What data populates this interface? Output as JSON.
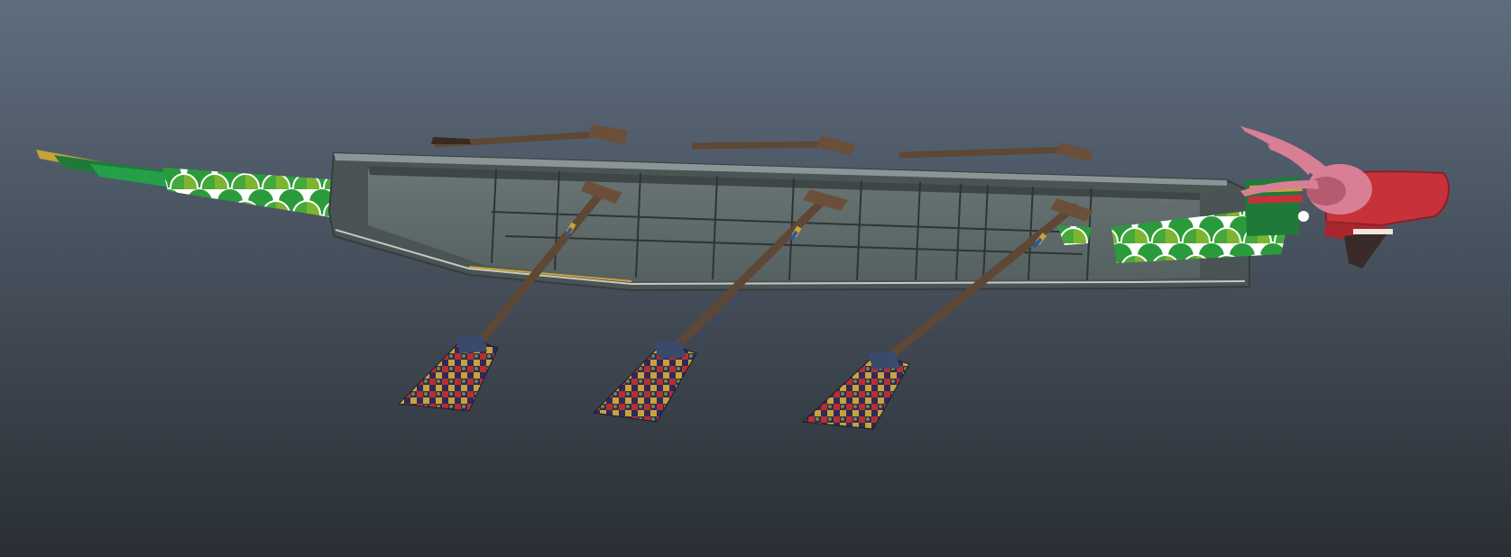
{
  "viewport": {
    "background_top": "#5f6d7e",
    "background_bottom": "#2a2f35"
  },
  "scene": {
    "object": "dragon-boat",
    "oars_count": 6,
    "colors": {
      "hull": "#5f6b6b",
      "hull_light": "#7e8a8a",
      "hull_dark": "#3e4646",
      "scale_green": "#1f9a33",
      "scale_light": "#8fbf2a",
      "oar_wood": "#5e4734",
      "dragon_red": "#c7323a",
      "dragon_pink": "#d97f95"
    }
  }
}
